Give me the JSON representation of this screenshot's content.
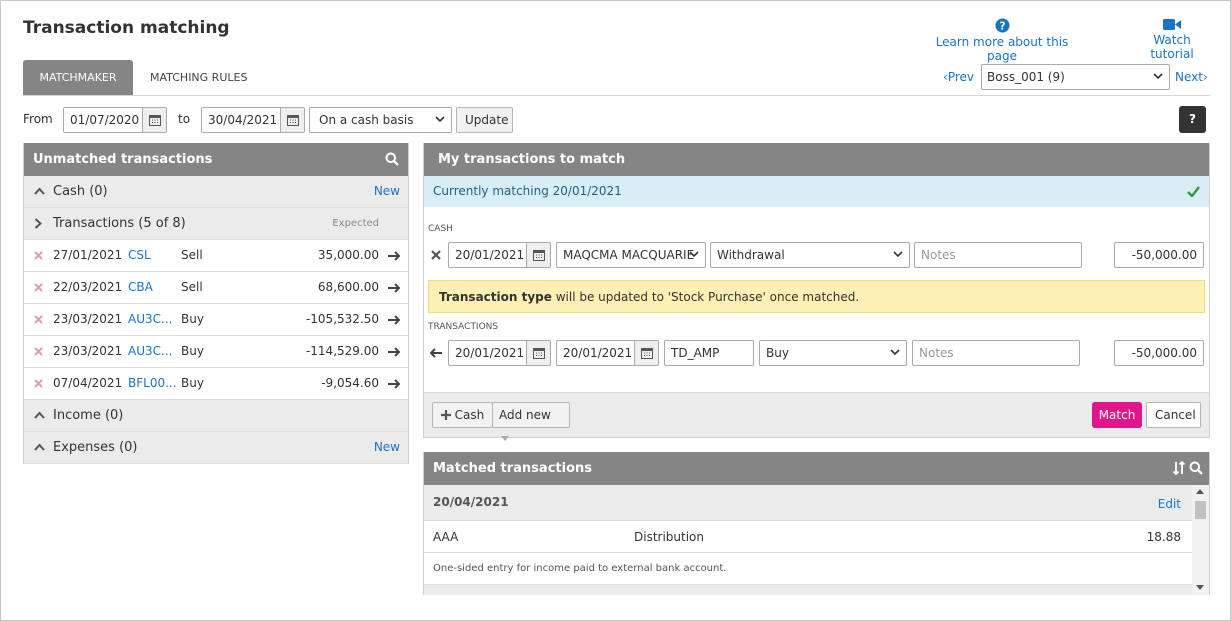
{
  "page": {
    "title": "Transaction matching",
    "learn_more": "Learn more about this page",
    "watch_tutorial": "Watch tutorial"
  },
  "tabs": [
    {
      "label": "MATCHMAKER",
      "active": true
    },
    {
      "label": "MATCHING RULES",
      "active": false
    }
  ],
  "pager": {
    "prev": "Prev",
    "next": "Next",
    "fund": "Boss_001 (9)"
  },
  "filters": {
    "from_label": "From",
    "from_date": "01/07/2020",
    "to_label": "to",
    "to_date": "30/04/2021",
    "basis": "On a cash basis",
    "update": "Update",
    "help": "?"
  },
  "unmatched": {
    "title": "Unmatched transactions",
    "cash": {
      "label": "Cash (0)",
      "action": "New"
    },
    "transactions": {
      "label": "Transactions (5 of 8)",
      "expected": "Expected"
    },
    "rows": [
      {
        "date": "27/01/2021",
        "code": "CSL",
        "type": "Sell",
        "amount": "35,000.00"
      },
      {
        "date": "22/03/2021",
        "code": "CBA",
        "type": "Sell",
        "amount": "68,600.00"
      },
      {
        "date": "23/03/2021",
        "code": "AU3C...",
        "type": "Buy",
        "amount": "-105,532.50"
      },
      {
        "date": "23/03/2021",
        "code": "AU3C...",
        "type": "Buy",
        "amount": "-114,529.00"
      },
      {
        "date": "07/04/2021",
        "code": "BFL00...",
        "type": "Buy",
        "amount": "-9,054.60"
      }
    ],
    "income": {
      "label": "Income (0)"
    },
    "expenses": {
      "label": "Expenses (0)",
      "action": "New"
    }
  },
  "my_match": {
    "title": "My transactions to match",
    "currently": "Currently matching 20/01/2021",
    "cash_section": "CASH",
    "cash_row": {
      "date": "20/01/2021",
      "account": "MAQCMA MACQUARIE",
      "type": "Withdrawal",
      "notes_placeholder": "Notes",
      "amount": "-50,000.00"
    },
    "warning_bold": "Transaction type",
    "warning_text": " will be updated to 'Stock Purchase' once matched.",
    "tx_section": "TRANSACTIONS",
    "tx_row": {
      "date1": "20/01/2021",
      "date2": "20/01/2021",
      "code": "TD_AMP",
      "type": "Buy",
      "notes_placeholder": "Notes",
      "amount": "-50,000.00"
    },
    "add_cash": "Cash",
    "add_new": "Add new",
    "match": "Match",
    "cancel": "Cancel"
  },
  "matched": {
    "title": "Matched transactions",
    "date": "20/04/2021",
    "edit": "Edit",
    "row": {
      "code": "AAA",
      "type": "Distribution",
      "amount": "18.88"
    },
    "note": "One-sided entry for income paid to external bank account."
  },
  "colors": {
    "header_gray": "#858585",
    "link_blue": "#1a74c4",
    "match_pink": "#e0168b",
    "info_blue": "#d9edf7",
    "warning_yellow": "#fcf0b4",
    "check_green": "#2e9c3a"
  }
}
